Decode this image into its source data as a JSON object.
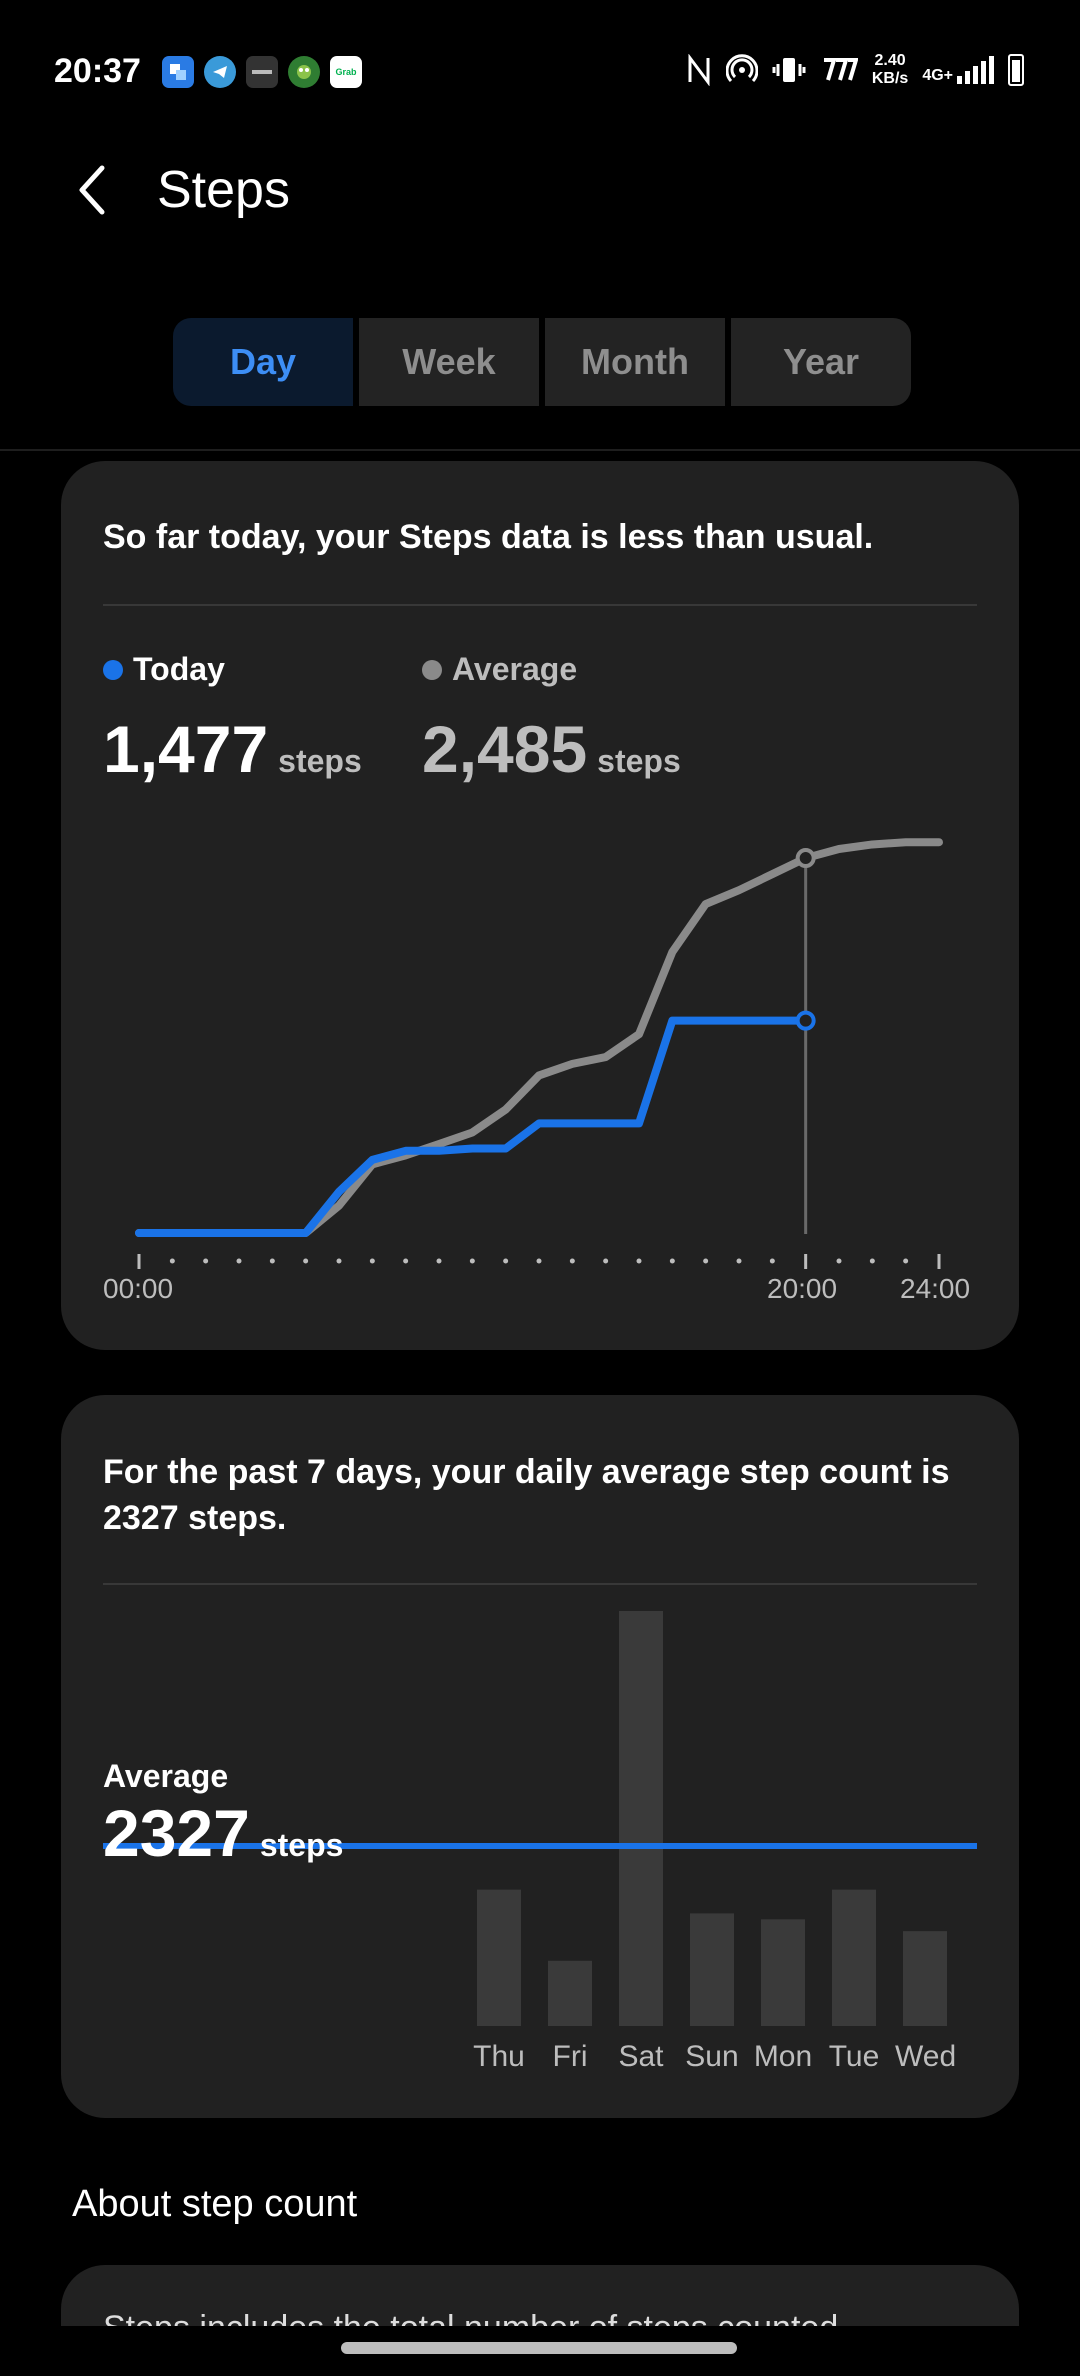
{
  "status_bar": {
    "time": "20:37",
    "speed_value": "2.40",
    "speed_unit": "KB/s",
    "network": "4G+",
    "app_icons": [
      "app-icon-blue",
      "telegram-icon",
      "app-icon-dark",
      "app-icon-green",
      "grab-icon"
    ],
    "grab_label": "Grab",
    "system_icons": [
      "nfc-icon",
      "hotspot-icon",
      "vibrate-icon",
      "speed-icon",
      "signal-icon",
      "battery-icon"
    ]
  },
  "header": {
    "back_icon": "chevron-left-icon",
    "title": "Steps"
  },
  "tabs": [
    {
      "label": "Day",
      "active": true
    },
    {
      "label": "Week",
      "active": false
    },
    {
      "label": "Month",
      "active": false
    },
    {
      "label": "Year",
      "active": false
    }
  ],
  "today_card": {
    "summary": "So far today, your Steps data is less than usual.",
    "today_label": "Today",
    "today_value": "1,477",
    "today_unit": "steps",
    "average_label": "Average",
    "average_value": "2,485",
    "average_unit": "steps",
    "colors": {
      "today": "#1a73e8",
      "average": "#8a8a8a"
    }
  },
  "weekly_card": {
    "summary": "For the past 7 days, your daily average step count is 2327 steps.",
    "average_label": "Average",
    "average_value": "2327",
    "average_unit": "steps",
    "line_color": "#1a73e8"
  },
  "about": {
    "title": "About step count",
    "body_partial": "Steps includes the total number of steps counted"
  },
  "chart_data": [
    {
      "type": "line",
      "x_unit": "hour",
      "xlim": [
        0,
        24
      ],
      "tick_labels": [
        "00:00",
        "20:00",
        "24:00"
      ],
      "series": [
        {
          "name": "Today",
          "x": [
            0,
            5,
            6,
            7,
            8,
            9,
            10,
            11,
            12,
            13,
            14,
            15,
            16,
            17,
            18,
            19,
            20
          ],
          "y": [
            0,
            0,
            182,
            323,
            363,
            363,
            373,
            373,
            484,
            484,
            484,
            484,
            938,
            938,
            938,
            938,
            938
          ]
        },
        {
          "name": "Average",
          "x": [
            0,
            5,
            6,
            7,
            8,
            9,
            10,
            11,
            12,
            13,
            14,
            15,
            16,
            17,
            18,
            19,
            20,
            21,
            22,
            23,
            24
          ],
          "y": [
            0,
            0,
            121,
            303,
            343,
            393,
            444,
            545,
            696,
            747,
            777,
            878,
            1241,
            1453,
            1514,
            1585,
            1656,
            1696,
            1716,
            1726,
            1726
          ]
        }
      ],
      "marker_x": 20
    },
    {
      "type": "bar",
      "categories": [
        "Thu",
        "Fri",
        "Sat",
        "Sun",
        "Mon",
        "Tue",
        "Wed"
      ],
      "values": [
        2300,
        1100,
        7000,
        1900,
        1800,
        2300,
        1600
      ],
      "average": 2327,
      "ylim": [
        0,
        7000
      ]
    }
  ]
}
